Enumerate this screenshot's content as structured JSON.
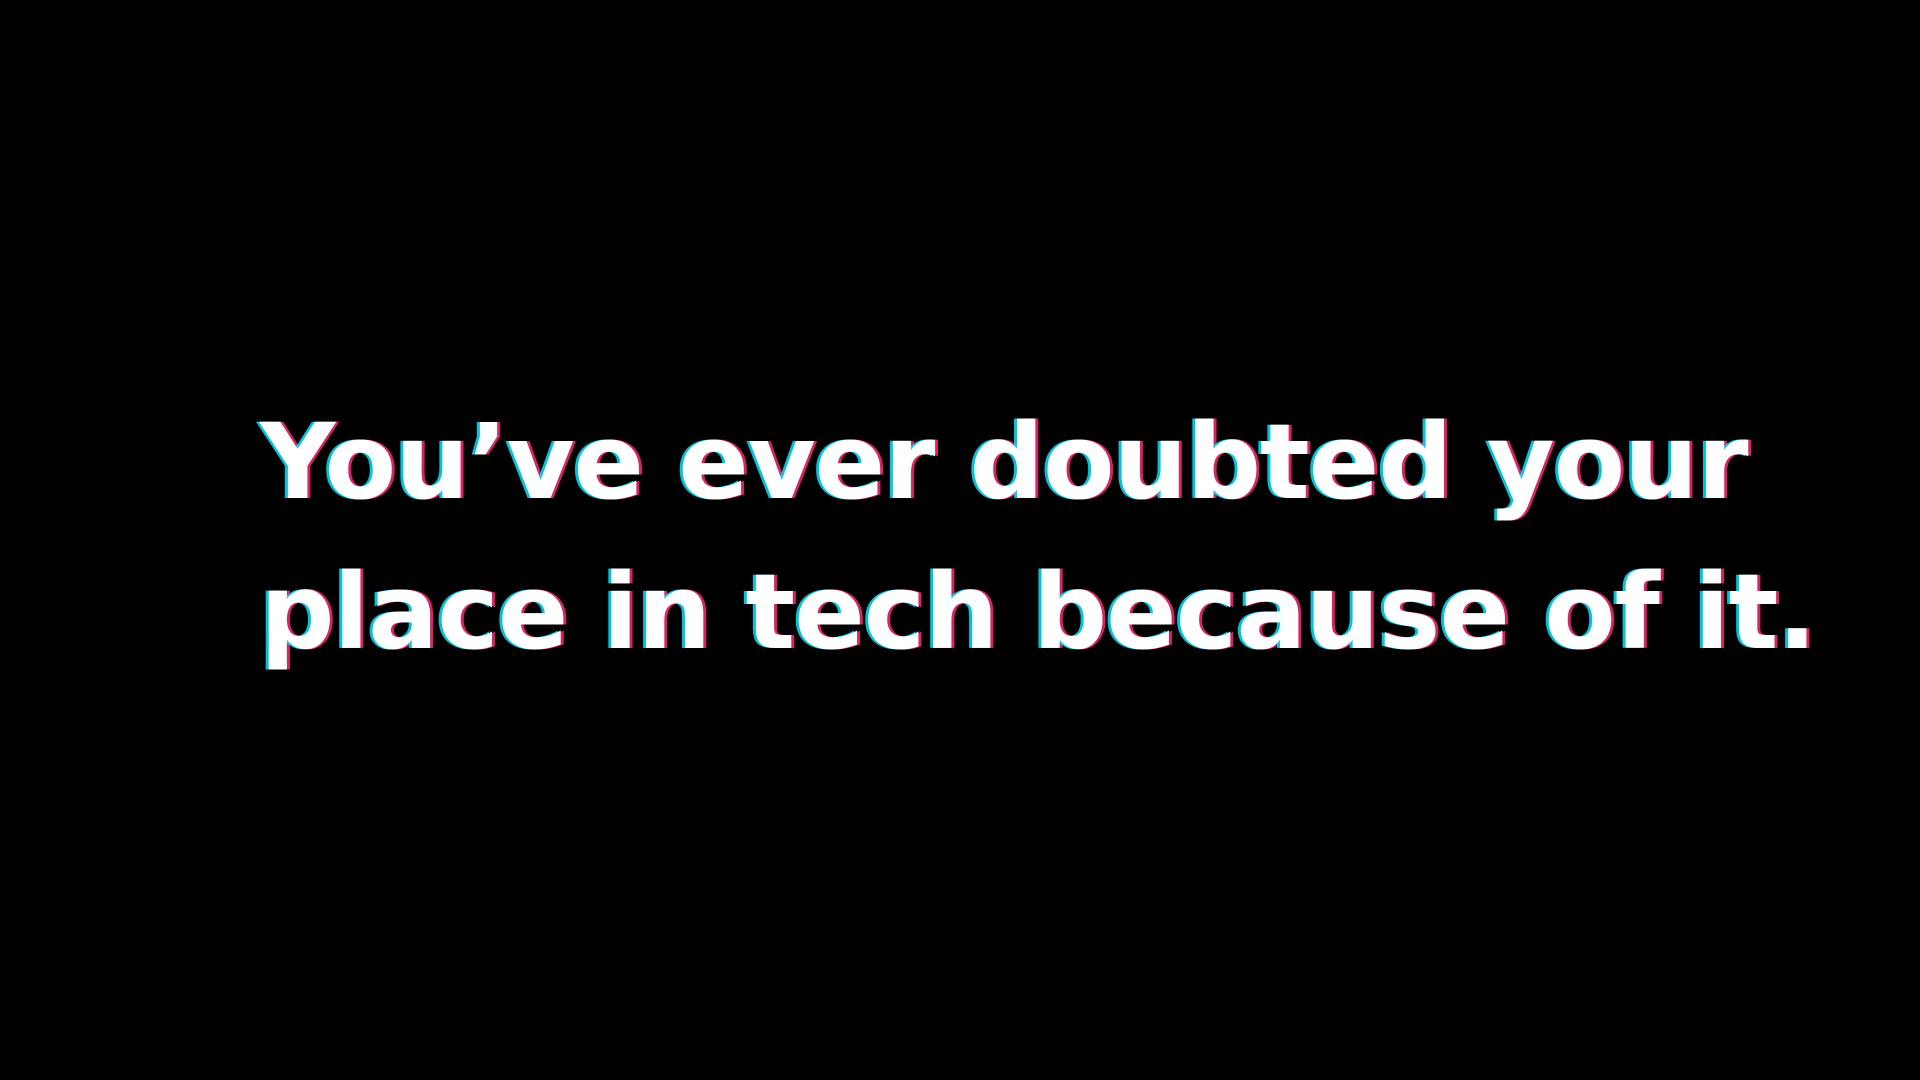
{
  "caption": {
    "line1": "You’ve ever doubted your",
    "line2": "place in tech because of it."
  },
  "colors": {
    "background": "#000000",
    "text": "#ffffff",
    "glitch_left": "#00e6ff",
    "glitch_right": "#ff2878"
  }
}
